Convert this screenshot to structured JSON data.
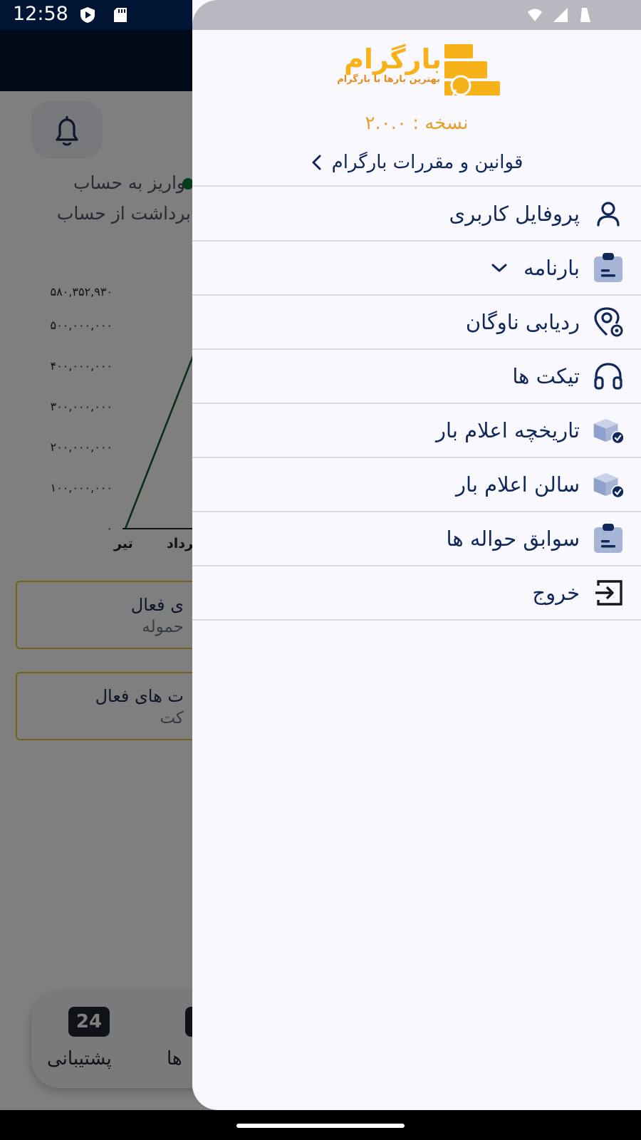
{
  "status_bar": {
    "time": "12:58"
  },
  "background_app": {
    "legend": {
      "deposit": "واریز به حساب",
      "withdrawal": "برداشت از حساب"
    },
    "chart_data": {
      "type": "line",
      "categories": [
        "تیر",
        "مرداد"
      ],
      "series": [
        {
          "values": [
            0,
            428000000
          ]
        }
      ],
      "yticks": [
        "۵۸۰,۳۵۲,۹۳۰",
        "۵۰۰,۰۰۰,۰۰۰",
        "۴۰۰,۰۰۰,۰۰۰",
        "۳۰۰,۰۰۰,۰۰۰",
        "۲۰۰,۰۰۰,۰۰۰",
        "۱۰۰,۰۰۰,۰۰۰",
        "۰"
      ],
      "ylim": [
        0,
        580352930
      ],
      "line_color": "#0a5a2c"
    },
    "card_1": {
      "title": "ی فعال",
      "subtitle": "حموله"
    },
    "card_2": {
      "title": "ت های فعال",
      "subtitle": "کت"
    },
    "bottom_nav": {
      "support_badge": "24",
      "support_label": "پشتیبانی",
      "tickets_label": "ها"
    }
  },
  "drawer": {
    "logo": {
      "brand": "بارگرام",
      "tagline": "بهترین بارها با بارگرام",
      "color": "#f7b21a"
    },
    "version": "نسخه : ۲.۰.۰",
    "terms_link": "قوانین و مقررات بارگرام",
    "menu": [
      {
        "label": "پروفایل کاربری",
        "icon": "user-icon"
      },
      {
        "label": "بارنامه",
        "icon": "clipboard-icon",
        "expandable": true
      },
      {
        "label": "ردیابی ناوگان",
        "icon": "location-pin-icon"
      },
      {
        "label": "تیکت ها",
        "icon": "headset-icon"
      },
      {
        "label": "تاریخچه اعلام بار",
        "icon": "box-check-icon"
      },
      {
        "label": "سالن اعلام بار",
        "icon": "box-check-icon"
      },
      {
        "label": "سوابق حواله ها",
        "icon": "clipboard-icon"
      },
      {
        "label": "خروج",
        "icon": "logout-icon"
      }
    ]
  }
}
